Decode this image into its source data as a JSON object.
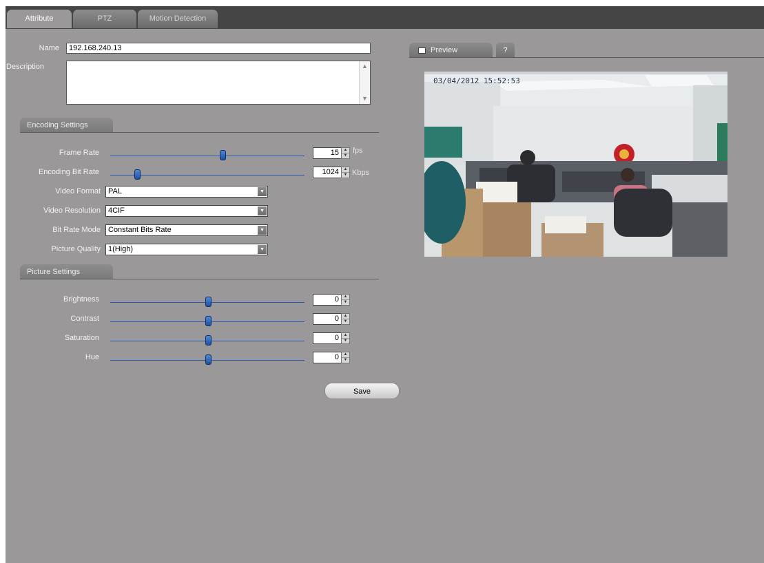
{
  "tabs": [
    {
      "label": "Attribute",
      "active": true
    },
    {
      "label": "PTZ",
      "active": false
    },
    {
      "label": "Motion Detection",
      "active": false
    }
  ],
  "name": {
    "label": "Name",
    "value": "192.168.240.13"
  },
  "description": {
    "label": "Description",
    "value": ""
  },
  "encoding": {
    "section_title": "Encoding Settings",
    "frame_rate": {
      "label": "Frame Rate",
      "value": "15",
      "unit": "fps",
      "slider_fraction": 0.58
    },
    "bit_rate": {
      "label": "Encoding Bit Rate",
      "value": "1024",
      "unit": "Kbps",
      "slider_fraction": 0.13
    },
    "video_format": {
      "label": "Video Format",
      "value": "PAL"
    },
    "video_resolution": {
      "label": "Video Resolution",
      "value": "4CIF"
    },
    "bit_rate_mode": {
      "label": "Bit Rate Mode",
      "value": "Constant Bits Rate"
    },
    "picture_quality": {
      "label": "Picture Quality",
      "value": "1(High)"
    }
  },
  "picture": {
    "section_title": "Picture Settings",
    "brightness": {
      "label": "Brightness",
      "value": "0",
      "slider_fraction": 0.5
    },
    "contrast": {
      "label": "Contrast",
      "value": "0",
      "slider_fraction": 0.5
    },
    "saturation": {
      "label": "Saturation",
      "value": "0",
      "slider_fraction": 0.5
    },
    "hue": {
      "label": "Hue",
      "value": "0",
      "slider_fraction": 0.5
    }
  },
  "save_label": "Save",
  "preview": {
    "tab_label": "Preview",
    "help_label": "?",
    "osd_timestamp": "03/04/2012   15:52:53"
  },
  "colors": {
    "panel": "#9a9899",
    "tabbar": "#454546",
    "slider": "#2a58b6"
  }
}
